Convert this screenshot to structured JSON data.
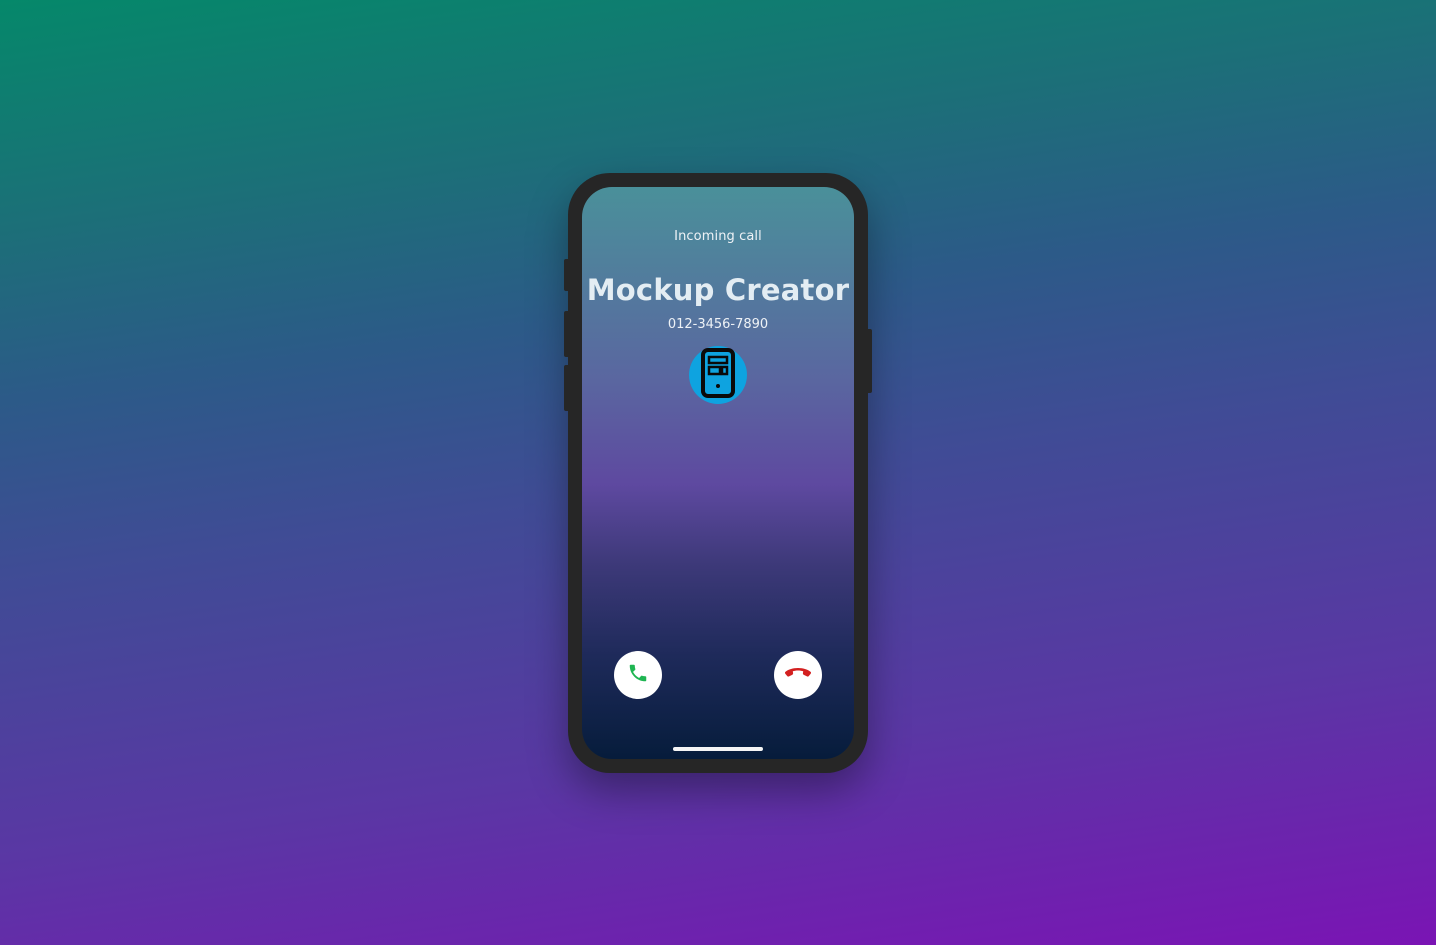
{
  "call": {
    "status_label": "Incoming call",
    "caller_name": "Mockup Creator",
    "caller_number": "012-3456-7890",
    "avatar_icon": "mobile-phone-icon"
  },
  "actions": {
    "accept_icon": "phone-accept-icon",
    "decline_icon": "phone-decline-icon"
  },
  "colors": {
    "accept": "#1fb552",
    "decline": "#d32020",
    "avatar_bg": "#0ea3e0"
  }
}
